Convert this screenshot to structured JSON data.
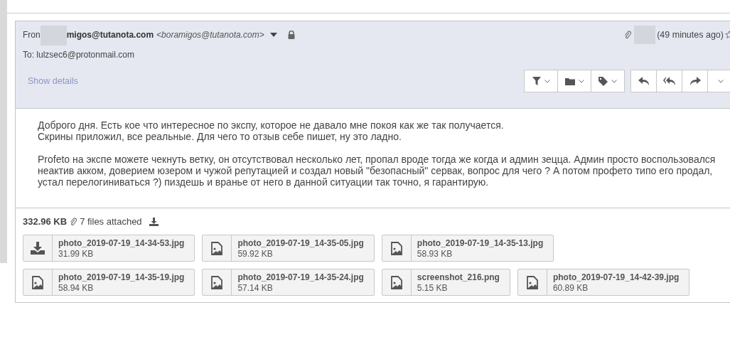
{
  "message": {
    "from_label": "Fron",
    "sender": "migos@tutanota.com",
    "sender_address": "<boramigos@tutanota.com>",
    "encrypted": true,
    "has_attachment": true,
    "time": "(49 minutes ago)",
    "starred": false,
    "to": "To: lulzsec6@protonmail.com",
    "show_details": "Show details",
    "toolbar_groups": [
      [
        {
          "kind": "filter",
          "dropdown": true
        },
        {
          "kind": "folder",
          "dropdown": true
        },
        {
          "kind": "tag",
          "dropdown": true
        }
      ],
      [
        {
          "kind": "reply",
          "dropdown": false
        },
        {
          "kind": "reply-all",
          "dropdown": false
        },
        {
          "kind": "forward",
          "dropdown": false
        },
        {
          "kind": "more",
          "dropdown": true
        }
      ]
    ],
    "body": [
      [
        "Доброго дня. Есть кое что интересное по экспу, которое не давало мне покоя как же так получается.",
        "Скрины приложил, все реальные. Для чего то отзыв себе пишет, ну это ладно."
      ],
      [
        "Profeto на экспе можете чекнуть ветку, он отсутствовал несколько лет, пропал вроде тогда же когда и админ зецца. Админ просто воспользовался неактив акком, доверием юзером и чужой репутацией и создал новый \"безопасный\" сервак, вопрос для чего ? А потом профето типо его продал, устал перелогиниваться ?) пиздешь и вранье от него в данной ситуации так точно, я гарантирую."
      ]
    ],
    "attachments_total": "332.96 KB",
    "attachments_count": "7 files attached",
    "attachments": [
      {
        "kind": "download",
        "name": "photo_2019-07-19_14-34-53.jpg",
        "size": "31.99 KB"
      },
      {
        "kind": "image",
        "name": "photo_2019-07-19_14-35-05.jpg",
        "size": "59.92 KB"
      },
      {
        "kind": "image",
        "name": "photo_2019-07-19_14-35-13.jpg",
        "size": "58.93 KB"
      },
      {
        "kind": "image",
        "name": "photo_2019-07-19_14-35-19.jpg",
        "size": "58.94 KB"
      },
      {
        "kind": "image",
        "name": "photo_2019-07-19_14-35-24.jpg",
        "size": "57.14 KB"
      },
      {
        "kind": "image",
        "name": "screenshot_216.png",
        "size": "5.15 KB"
      },
      {
        "kind": "image",
        "name": "photo_2019-07-19_14-42-39.jpg",
        "size": "60.89 KB"
      }
    ]
  }
}
